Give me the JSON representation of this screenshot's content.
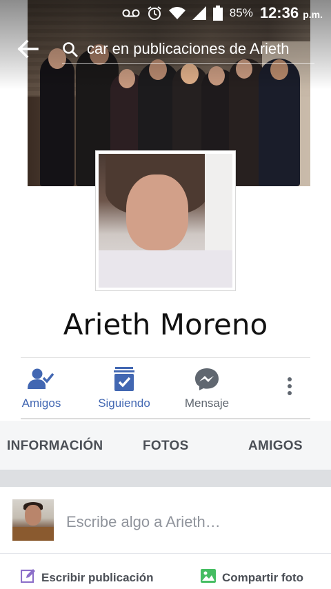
{
  "status_bar": {
    "battery": "85%",
    "time": "12:36",
    "ampm": "p.m.",
    "icons": [
      "voicemail-icon",
      "alarm-icon",
      "wifi-icon",
      "signal-icon",
      "battery-icon"
    ]
  },
  "header": {
    "search_text": "car en publicaciones de Arieth",
    "back_icon": "back-arrow-icon",
    "search_icon": "search-icon"
  },
  "profile": {
    "name": "Arieth Moreno"
  },
  "actions": [
    {
      "label": "Amigos",
      "icon": "friends-check-icon",
      "color": "#4267b2"
    },
    {
      "label": "Siguiendo",
      "icon": "following-check-icon",
      "color": "#4267b2"
    },
    {
      "label": "Mensaje",
      "icon": "messenger-icon",
      "color": "#606770"
    },
    {
      "label": "",
      "icon": "more-vertical-icon",
      "color": "#606770"
    }
  ],
  "tabs": [
    {
      "label": "INFORMACIÓN"
    },
    {
      "label": "FOTOS"
    },
    {
      "label": "AMIGOS"
    }
  ],
  "composer": {
    "placeholder": "Escribe algo a Arieth…",
    "write_label": "Escribir publicación",
    "photo_label": "Compartir foto"
  },
  "colors": {
    "accent": "#4267b2",
    "write_icon": "#8c6fc9",
    "photo_icon": "#45bd62"
  }
}
